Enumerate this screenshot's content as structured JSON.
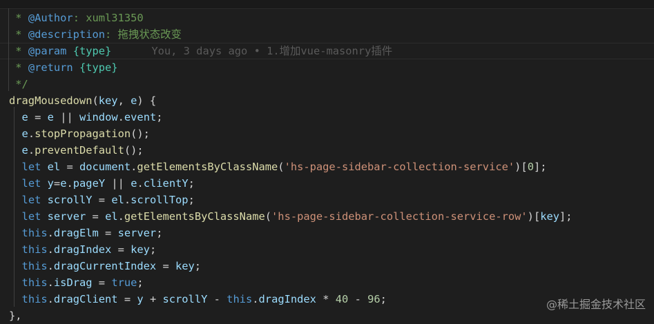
{
  "code_lines": [
    {
      "indent": "",
      "tokens": [
        [
          " * ",
          "comment"
        ],
        [
          "@Author",
          "tag"
        ],
        [
          ": xuml31350",
          "comment"
        ]
      ]
    },
    {
      "indent": "",
      "tokens": [
        [
          " * ",
          "comment"
        ],
        [
          "@description",
          "tag"
        ],
        [
          ": 拖拽状态改变",
          "comment"
        ]
      ]
    },
    {
      "indent": "",
      "tokens": [
        [
          " * ",
          "comment"
        ],
        [
          "@param",
          "tag"
        ],
        [
          " ",
          "comment"
        ],
        [
          "{type}",
          "type"
        ]
      ],
      "blame": "You, 3 days ago • 1.增加vue-masonry插件"
    },
    {
      "indent": "",
      "tokens": [
        [
          " * ",
          "comment"
        ],
        [
          "@return",
          "tag"
        ],
        [
          " ",
          "comment"
        ],
        [
          "{type}",
          "type"
        ]
      ]
    },
    {
      "indent": "",
      "tokens": [
        [
          " */",
          "comment"
        ]
      ]
    },
    {
      "indent": "",
      "tokens": [
        [
          "dragMousedown",
          "fn"
        ],
        [
          "(",
          "plain"
        ],
        [
          "key",
          "var"
        ],
        [
          ", ",
          "plain"
        ],
        [
          "e",
          "var"
        ],
        [
          ") {",
          "plain"
        ]
      ]
    },
    {
      "indent": "  ",
      "tokens": [
        [
          "e",
          "var"
        ],
        [
          " = ",
          "plain"
        ],
        [
          "e",
          "var"
        ],
        [
          " || ",
          "plain"
        ],
        [
          "window",
          "var"
        ],
        [
          ".",
          "plain"
        ],
        [
          "event",
          "var"
        ],
        [
          ";",
          "plain"
        ]
      ]
    },
    {
      "indent": "  ",
      "tokens": [
        [
          "e",
          "var"
        ],
        [
          ".",
          "plain"
        ],
        [
          "stopPropagation",
          "fn"
        ],
        [
          "();",
          "plain"
        ]
      ]
    },
    {
      "indent": "  ",
      "tokens": [
        [
          "e",
          "var"
        ],
        [
          ".",
          "plain"
        ],
        [
          "preventDefault",
          "fn"
        ],
        [
          "();",
          "plain"
        ]
      ]
    },
    {
      "indent": "  ",
      "tokens": [
        [
          "let",
          "kw"
        ],
        [
          " ",
          "plain"
        ],
        [
          "el",
          "var"
        ],
        [
          " = ",
          "plain"
        ],
        [
          "document",
          "var"
        ],
        [
          ".",
          "plain"
        ],
        [
          "getElementsByClassName",
          "fn"
        ],
        [
          "(",
          "plain"
        ],
        [
          "'hs-page-sidebar-collection-service'",
          "str"
        ],
        [
          ")[",
          "plain"
        ],
        [
          "0",
          "num"
        ],
        [
          "];",
          "plain"
        ]
      ]
    },
    {
      "indent": "  ",
      "tokens": [
        [
          "let",
          "kw"
        ],
        [
          " ",
          "plain"
        ],
        [
          "y",
          "var"
        ],
        [
          "=",
          "plain"
        ],
        [
          "e",
          "var"
        ],
        [
          ".",
          "plain"
        ],
        [
          "pageY",
          "var"
        ],
        [
          " || ",
          "plain"
        ],
        [
          "e",
          "var"
        ],
        [
          ".",
          "plain"
        ],
        [
          "clientY",
          "var"
        ],
        [
          ";",
          "plain"
        ]
      ]
    },
    {
      "indent": "  ",
      "tokens": [
        [
          "let",
          "kw"
        ],
        [
          " ",
          "plain"
        ],
        [
          "scrollY",
          "var"
        ],
        [
          " = ",
          "plain"
        ],
        [
          "el",
          "var"
        ],
        [
          ".",
          "plain"
        ],
        [
          "scrollTop",
          "var"
        ],
        [
          ";",
          "plain"
        ]
      ]
    },
    {
      "indent": "  ",
      "tokens": [
        [
          "let",
          "kw"
        ],
        [
          " ",
          "plain"
        ],
        [
          "server",
          "var"
        ],
        [
          " = ",
          "plain"
        ],
        [
          "el",
          "var"
        ],
        [
          ".",
          "plain"
        ],
        [
          "getElementsByClassName",
          "fn"
        ],
        [
          "(",
          "plain"
        ],
        [
          "'hs-page-sidebar-collection-service-row'",
          "str"
        ],
        [
          ")[",
          "plain"
        ],
        [
          "key",
          "var"
        ],
        [
          "];",
          "plain"
        ]
      ]
    },
    {
      "indent": "  ",
      "tokens": [
        [
          "this",
          "kw"
        ],
        [
          ".",
          "plain"
        ],
        [
          "dragElm",
          "var"
        ],
        [
          " = ",
          "plain"
        ],
        [
          "server",
          "var"
        ],
        [
          ";",
          "plain"
        ]
      ]
    },
    {
      "indent": "  ",
      "tokens": [
        [
          "this",
          "kw"
        ],
        [
          ".",
          "plain"
        ],
        [
          "dragIndex",
          "var"
        ],
        [
          " = ",
          "plain"
        ],
        [
          "key",
          "var"
        ],
        [
          ";",
          "plain"
        ]
      ]
    },
    {
      "indent": "  ",
      "tokens": [
        [
          "this",
          "kw"
        ],
        [
          ".",
          "plain"
        ],
        [
          "dragCurrentIndex",
          "var"
        ],
        [
          " = ",
          "plain"
        ],
        [
          "key",
          "var"
        ],
        [
          ";",
          "plain"
        ]
      ]
    },
    {
      "indent": "  ",
      "tokens": [
        [
          "this",
          "kw"
        ],
        [
          ".",
          "plain"
        ],
        [
          "isDrag",
          "var"
        ],
        [
          " = ",
          "plain"
        ],
        [
          "true",
          "kw"
        ],
        [
          ";",
          "plain"
        ]
      ]
    },
    {
      "indent": "  ",
      "tokens": [
        [
          "this",
          "kw"
        ],
        [
          ".",
          "plain"
        ],
        [
          "dragClient",
          "var"
        ],
        [
          " = ",
          "plain"
        ],
        [
          "y",
          "var"
        ],
        [
          " + ",
          "plain"
        ],
        [
          "scrollY",
          "var"
        ],
        [
          " - ",
          "plain"
        ],
        [
          "this",
          "kw"
        ],
        [
          ".",
          "plain"
        ],
        [
          "dragIndex",
          "var"
        ],
        [
          " * ",
          "plain"
        ],
        [
          "40",
          "num"
        ],
        [
          " - ",
          "plain"
        ],
        [
          "96",
          "num"
        ],
        [
          ";",
          "plain"
        ]
      ]
    },
    {
      "indent": "",
      "tokens": [
        [
          "},",
          "plain"
        ]
      ]
    }
  ],
  "watermark": "@稀土掘金技术社区"
}
